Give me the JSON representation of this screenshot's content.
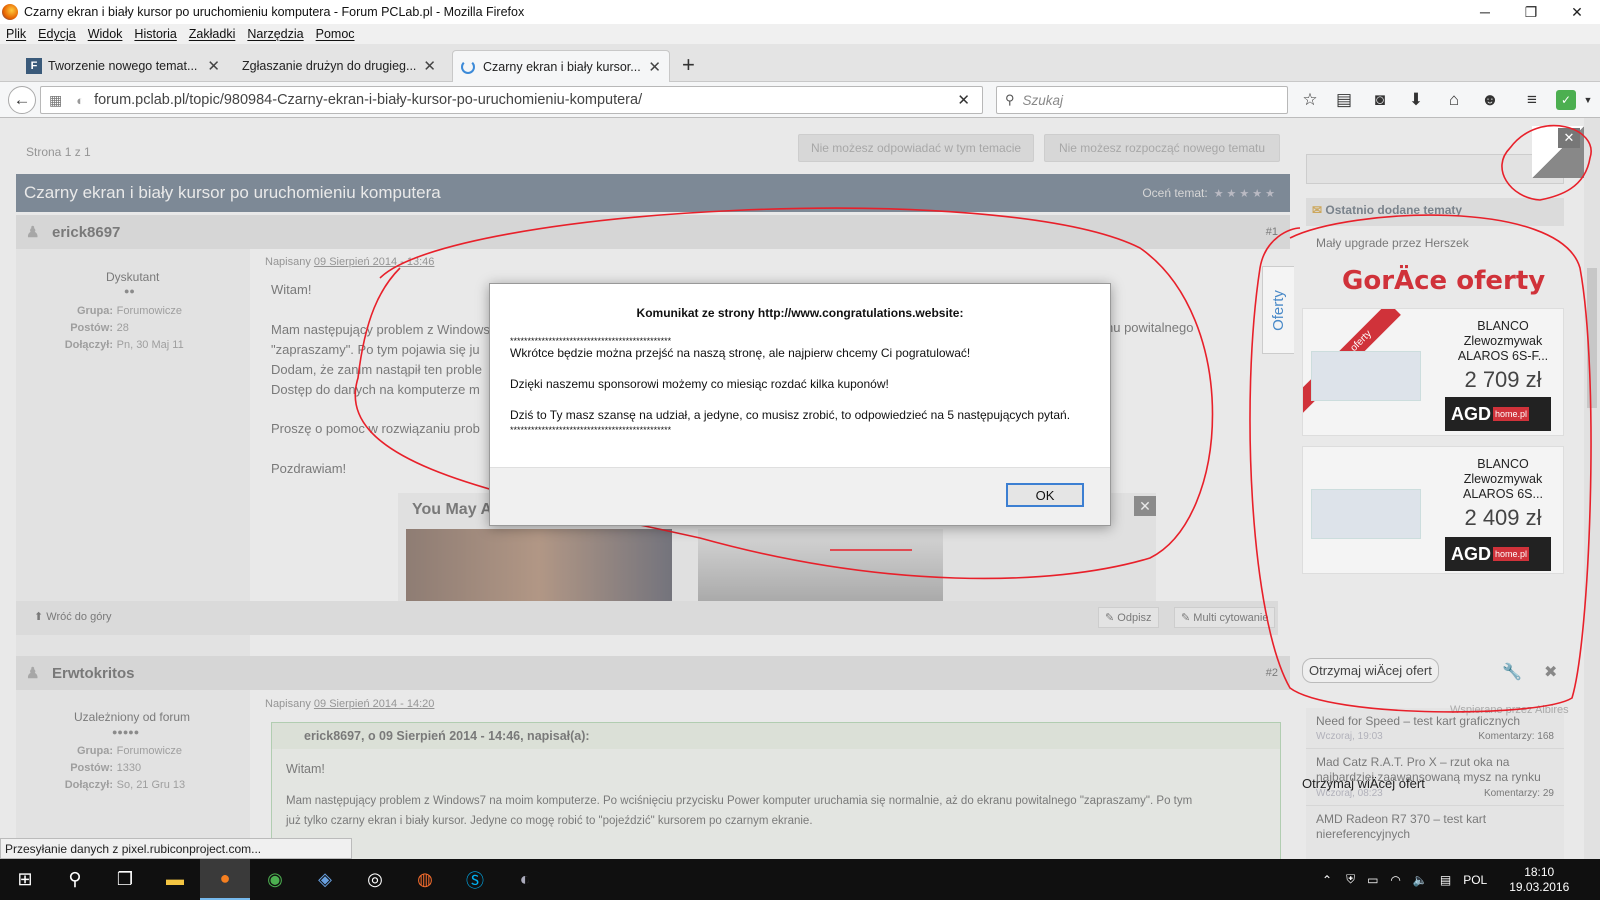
{
  "window": {
    "title": "Czarny ekran i biały kursor po uruchomieniu komputera - Forum PCLab.pl - Mozilla Firefox",
    "minimize": "─",
    "maximize": "❐",
    "close": "✕"
  },
  "menu": [
    "Plik",
    "Edycja",
    "Widok",
    "Historia",
    "Zakładki",
    "Narzędzia",
    "Pomoc"
  ],
  "tabs": [
    {
      "label": "Tworzenie nowego temat...",
      "icon": "F"
    },
    {
      "label": "Zgłaszanie drużyn do drugieg..."
    },
    {
      "label": "Czarny ekran i biały kursor..."
    }
  ],
  "nav": {
    "url": "forum.pclab.pl/topic/980984-Czarny-ekran-i-biały-kursor-po-uruchomieniu-komputera/",
    "search_placeholder": "Szukaj"
  },
  "forum": {
    "page_info": "Strona 1 z 1",
    "btn_reply_disabled": "Nie możesz odpowiadać w tym temacie",
    "btn_new_disabled": "Nie możesz rozpocząć nowego tematu",
    "topic_title": "Czarny ekran i biały kursor po uruchomieniu komputera",
    "rate_label": "Oceń temat:",
    "rate_stars": "★★★★★",
    "back_top": "Wróć do góry",
    "reply": "Odpisz",
    "multiquote": "Multi cytowanie",
    "you_may_also": "You May Also Li...",
    "post1": {
      "author": "erick8697",
      "num": "#1",
      "rank": "Dyskutant",
      "rank_dots": "●●",
      "group_label": "Grupa:",
      "group": "Forumowicze",
      "posts_label": "Postów:",
      "posts": "28",
      "joined_label": "Dołączył:",
      "joined": "Pn, 30 Maj 11",
      "date_prefix": "Napisany",
      "date": "09 Sierpień 2014 - 13:46",
      "lines": [
        "Witam!",
        "Mam następujący problem z Windows",
        "\"zapraszamy\". Po tym pojawia się ju",
        "Dodam, że zanim nastąpił ten proble",
        "Dostęp do danych na komputerze m",
        "Proszę o pomoc w rozwiązaniu prob",
        "Pozdrawiam!"
      ],
      "line_right": "nu powitalnego"
    },
    "post2": {
      "author": "Erwtokritos",
      "num": "#2",
      "rank": "Uzależniony od forum",
      "rank_dots": "●●●●●",
      "group_label": "Grupa:",
      "group": "Forumowicze",
      "posts_label": "Postów:",
      "posts": "1330",
      "joined_label": "Dołączył:",
      "joined": "So, 21 Gru 13",
      "date_prefix": "Napisany",
      "date": "09 Sierpień 2014 - 14:20",
      "quote_head": "erick8697, o 09 Sierpień 2014 - 14:46, napisał(a):",
      "quote_lines": [
        "Witam!",
        "Mam następujący problem z Windows7 na moim komputerze. Po wciśnięciu przycisku Power komputer uruchamia się normalnie, aż do ekranu powitalnego \"zapraszamy\". Po tym",
        "już tylko czarny ekran i biały kursor. Jedyne co mogę robić to \"pojeździć\" kursorem po czarnym ekranie."
      ]
    }
  },
  "sidebar": {
    "recent_title": "Ostatnio dodane tematy",
    "recent_first": "Mały upgrade przez Herszek",
    "ad_title": "GorÄce oferty",
    "ad_tab": "Oferty",
    "ad_ribbon": "Najlepsze oferty",
    "offers": [
      {
        "name": "BLANCO Zlewozmywak ALAROS 6S-F...",
        "price": "2 709 zł",
        "shop": "AGD",
        "shop_sub": "home.pl"
      },
      {
        "name": "BLANCO Zlewozmywak ALAROS 6S...",
        "price": "2 409 zł",
        "shop": "AGD",
        "shop_sub": "home.pl"
      }
    ],
    "more_offers": "Otrzymaj wiÄcej ofert",
    "powered": "Wspierane przez Albires",
    "articles": [
      {
        "title": "Need for Speed – test kart graficznych",
        "date": "Wczoraj, 19:03",
        "comments": "Komentarzy: 168"
      },
      {
        "title": "Mad Catz R.A.T. Pro X – rzut oka na najbardziej zaawansowaną mysz na rynku",
        "date": "Wczoraj, 08:23",
        "comments": "Komentarzy: 29"
      },
      {
        "title": "AMD Radeon R7 370 – test kart niereferencyjnych",
        "date": "",
        "comments": ""
      }
    ]
  },
  "dialog": {
    "title": "Komunikat ze strony http://www.congratulations.website:",
    "stars": "**********************************************",
    "line1": "Wkrótce będzie można przejść na naszą stronę, ale najpierw chcemy Ci pogratulować!",
    "line2": "Dzięki naszemu sponsorowi możemy co miesiąc rozdać kilka kuponów!",
    "line3": "Dziś to Ty masz szansę na udział, a jedyne, co musisz zrobić, to odpowiedzieć na 5 następujących pytań.",
    "ok": "OK"
  },
  "status": "Przesyłanie danych z pixel.rubiconproject.com...",
  "taskbar": {
    "lang": "POL",
    "time": "18:10",
    "date": "19.03.2016"
  },
  "colors": {
    "accent": "#3c7fd2",
    "annotation": "#e8202a",
    "topicbar": "#3b5068",
    "ad_red": "#d0323a"
  }
}
